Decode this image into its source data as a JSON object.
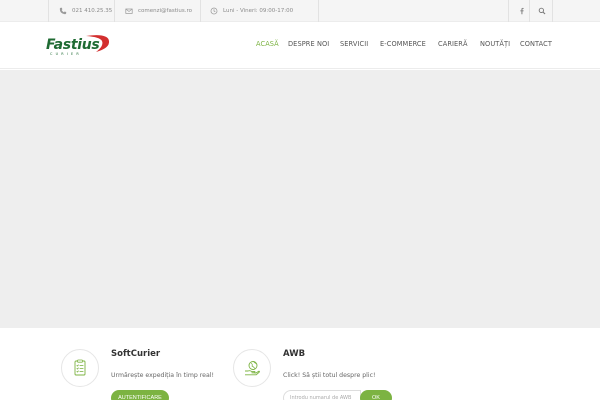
{
  "topbar": {
    "phone": "021 410.25.35",
    "email": "comenzi@fastius.ro",
    "hours": "Luni - Vineri: 09:00-17:00"
  },
  "logo": {
    "name": "Fastius",
    "tagline": "CURIER"
  },
  "nav": {
    "items": [
      "ACASĂ",
      "DESPRE NOI",
      "SERVICII",
      "E-COMMERCE",
      "CARIERĂ",
      "NOUTĂȚI",
      "CONTACT"
    ],
    "active_index": 0
  },
  "services": [
    {
      "title": "SoftCurier",
      "description": "Urmărește expediția în timp real!",
      "button_label": "AUTENTIFICARE"
    },
    {
      "title": "AWB",
      "description": "Click! Să știi totul despre plic!",
      "input_placeholder": "Introdu numarul de AWB",
      "button_label": "OK"
    }
  ],
  "colors": {
    "accent": "#7cb342",
    "brand_green": "#1f6b33",
    "brand_red": "#d32f2f",
    "hero_bg": "#eeeeee"
  }
}
